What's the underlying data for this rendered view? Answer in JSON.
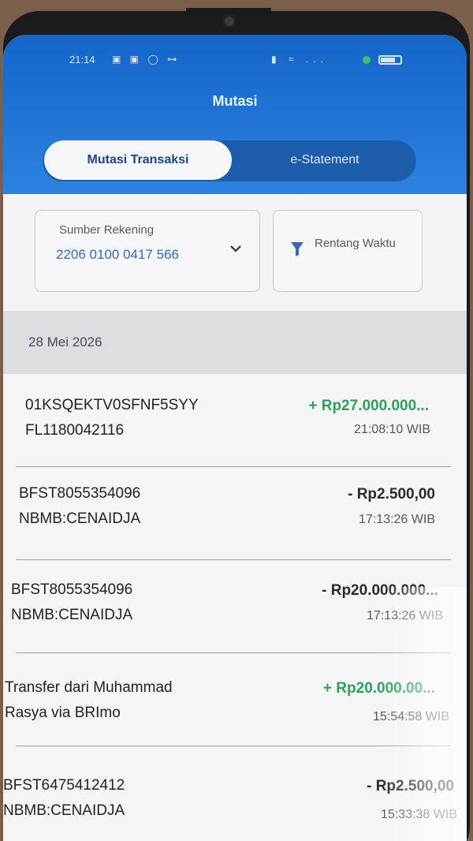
{
  "status_bar": {
    "time": "21:14",
    "icons_left": "▣ ▣ ◯ ⊶",
    "icons_right": "▮ ≈ ..."
  },
  "header": {
    "title": "Mutasi"
  },
  "tabs": [
    {
      "label": "Mutasi Transaksi",
      "active": true
    },
    {
      "label": "e-Statement",
      "active": false
    }
  ],
  "filters": {
    "account": {
      "label": "Sumber Rekening",
      "number": "2206 0100 0417 566"
    },
    "range": {
      "label": "Rentang Waktu"
    }
  },
  "date_header": "28 Mei 2026",
  "transactions": [
    {
      "desc1": "01KSQEKTV0SFNF5SYY",
      "desc2": "FL1180042116",
      "amount": "+ Rp27.000.000...",
      "time": "21:08:10 WIB",
      "type": "credit"
    },
    {
      "desc1": "BFST8055354096",
      "desc2": "NBMB:CENAIDJA",
      "amount": "- Rp2.500,00",
      "time": "17:13:26 WIB",
      "type": "debit"
    },
    {
      "desc1": "BFST8055354096",
      "desc2": "NBMB:CENAIDJA",
      "amount": "- Rp20.000.000...",
      "time": "17:13:26 WIB",
      "type": "debit"
    },
    {
      "desc1": "Transfer dari Muhammad",
      "desc2": "Rasya via BRImo",
      "amount": "+ Rp20.000.00...",
      "time": "15:54:58 WIB",
      "type": "credit"
    },
    {
      "desc1": "BFST6475412412",
      "desc2": "NBMB:CENAIDJA",
      "amount": "- Rp2.500,00",
      "time": "15:33:38 WIB",
      "type": "debit"
    }
  ],
  "colors": {
    "header_blue": "#1565c9",
    "credit_green": "#2aa35a",
    "account_blue": "#2e6bc6"
  }
}
